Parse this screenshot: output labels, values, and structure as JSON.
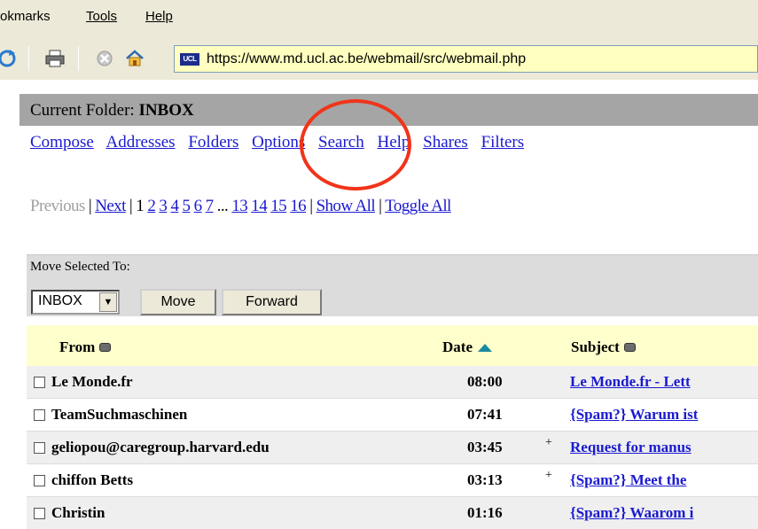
{
  "browser": {
    "menu": [
      "okmarks",
      "Tools",
      "Help"
    ],
    "url": "https://www.md.ucl.ac.be/webmail/src/webmail.php",
    "site_badge": "UCL"
  },
  "webmail": {
    "folder_label": "Current Folder:",
    "folder_name": "INBOX",
    "nav": [
      "Compose",
      "Addresses",
      "Folders",
      "Options",
      "Search",
      "Help",
      "Shares",
      "Filters"
    ],
    "pagination": {
      "previous": "Previous",
      "next": "Next",
      "current": "1",
      "pages": [
        "2",
        "3",
        "4",
        "5",
        "6",
        "7"
      ],
      "ellipsis": "...",
      "last_pages": [
        "13",
        "14",
        "15",
        "16"
      ],
      "show_all": "Show All",
      "toggle_all": "Toggle All"
    },
    "move": {
      "label": "Move Selected To:",
      "selected_folder": "INBOX",
      "move_button": "Move",
      "forward_button": "Forward"
    },
    "columns": {
      "from": "From",
      "date": "Date",
      "subject": "Subject"
    },
    "messages": [
      {
        "from": "Le Monde.fr",
        "date": "08:00",
        "plus": "",
        "subject": "Le Monde.fr - Lett"
      },
      {
        "from": "TeamSuchmaschinen",
        "date": "07:41",
        "plus": "",
        "subject": "{Spam?} Warum ist"
      },
      {
        "from": "geliopou@caregroup.harvard.edu",
        "date": "03:45",
        "plus": "+",
        "subject": "Request for manus"
      },
      {
        "from": "chiffon Betts",
        "date": "03:13",
        "plus": "+",
        "subject": "{Spam?} Meet the"
      },
      {
        "from": "Christin",
        "date": "01:16",
        "plus": "",
        "subject": "{Spam?} Waarom i"
      }
    ]
  }
}
